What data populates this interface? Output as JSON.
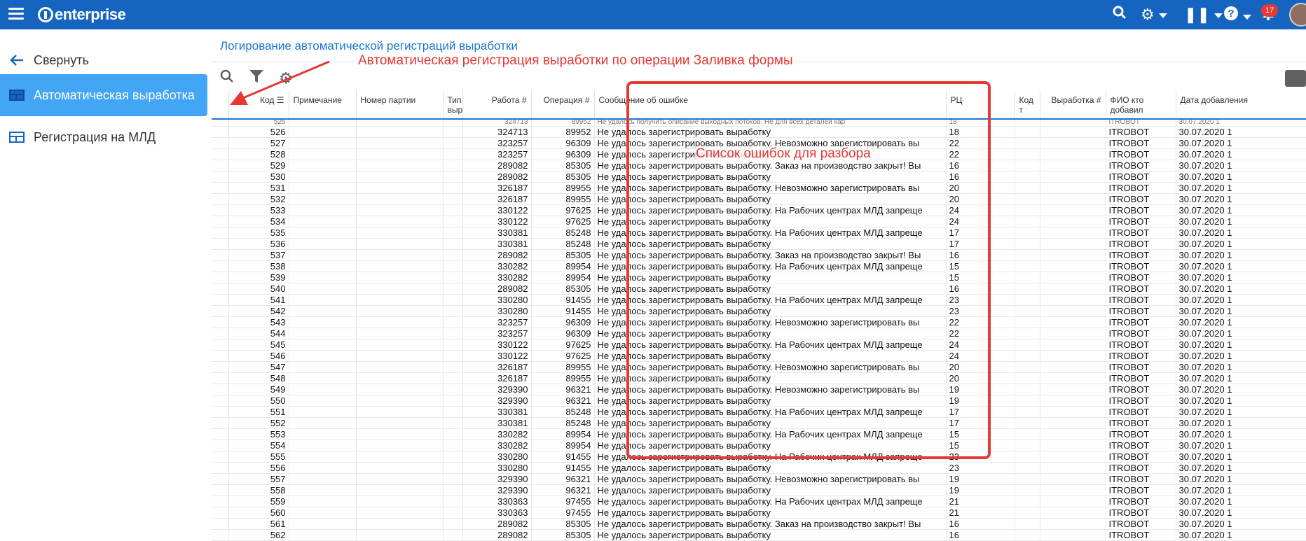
{
  "topbar": {
    "logo_text": "enterprise",
    "notification_count": "17",
    "icons": [
      "menu-icon",
      "search-icon",
      "gear-icon",
      "pause-icon",
      "help-icon",
      "bell-icon"
    ]
  },
  "sidebar": {
    "collapse_label": "Свернуть",
    "items": [
      {
        "label": "Автоматическая выработка",
        "active": true
      },
      {
        "label": "Регистрация на МЛД",
        "active": false
      }
    ]
  },
  "page": {
    "title": "Логирование автоматической регистраций выработки"
  },
  "table": {
    "headers": [
      "",
      "Код",
      "Примечание",
      "Номер партии",
      "Тип выр",
      "Работа #",
      "Операция #",
      "Сообщение об ошибке",
      "РЦ",
      "Код т",
      "Выработка #",
      "ФИО кто добавил",
      "Дата добавления"
    ],
    "cut_row": {
      "kod": "525",
      "rabota": "324713",
      "op": "89952",
      "msg": "Не удалось получить описание выходных потоков. Не для всех деталей кар",
      "rc": "18",
      "fio": "ITROBOT",
      "date": "30.07.2020 1"
    },
    "rows": [
      {
        "kod": "526",
        "rabota": "324713",
        "op": "89952",
        "msg": "Не удалось зарегистрировать выработку",
        "rc": "18"
      },
      {
        "kod": "527",
        "rabota": "323257",
        "op": "96309",
        "msg": "Не удалось зарегистрировать выработку. Невозможно зарегистрировать вы",
        "rc": "22"
      },
      {
        "kod": "528",
        "rabota": "323257",
        "op": "96309",
        "msg": "Не удалось зарегистрировать выработку",
        "rc": "22"
      },
      {
        "kod": "529",
        "rabota": "289082",
        "op": "85305",
        "msg": "Не удалось зарегистрировать выработку. Заказ на производство закрыт! Вы",
        "rc": "16"
      },
      {
        "kod": "530",
        "rabota": "289082",
        "op": "85305",
        "msg": "Не удалось зарегистрировать выработку",
        "rc": "16"
      },
      {
        "kod": "531",
        "rabota": "326187",
        "op": "89955",
        "msg": "Не удалось зарегистрировать выработку. Невозможно зарегистрировать вы",
        "rc": "20"
      },
      {
        "kod": "532",
        "rabota": "326187",
        "op": "89955",
        "msg": "Не удалось зарегистрировать выработку",
        "rc": "20"
      },
      {
        "kod": "533",
        "rabota": "330122",
        "op": "97625",
        "msg": "Не удалось зарегистрировать выработку. На Рабочих центрах МЛД запреще",
        "rc": "24"
      },
      {
        "kod": "534",
        "rabota": "330122",
        "op": "97625",
        "msg": "Не удалось зарегистрировать выработку",
        "rc": "24"
      },
      {
        "kod": "535",
        "rabota": "330381",
        "op": "85248",
        "msg": "Не удалось зарегистрировать выработку. На Рабочих центрах МЛД запреще",
        "rc": "17"
      },
      {
        "kod": "536",
        "rabota": "330381",
        "op": "85248",
        "msg": "Не удалось зарегистрировать выработку",
        "rc": "17"
      },
      {
        "kod": "537",
        "rabota": "289082",
        "op": "85305",
        "msg": "Не удалось зарегистрировать выработку. Заказ на производство закрыт! Вы",
        "rc": "16"
      },
      {
        "kod": "538",
        "rabota": "330282",
        "op": "89954",
        "msg": "Не удалось зарегистрировать выработку. На Рабочих центрах МЛД запреще",
        "rc": "15"
      },
      {
        "kod": "539",
        "rabota": "330282",
        "op": "89954",
        "msg": "Не удалось зарегистрировать выработку",
        "rc": "15"
      },
      {
        "kod": "540",
        "rabota": "289082",
        "op": "85305",
        "msg": "Не удалось зарегистрировать выработку",
        "rc": "16"
      },
      {
        "kod": "541",
        "rabota": "330280",
        "op": "91455",
        "msg": "Не удалось зарегистрировать выработку. На Рабочих центрах МЛД запреще",
        "rc": "23"
      },
      {
        "kod": "542",
        "rabota": "330280",
        "op": "91455",
        "msg": "Не удалось зарегистрировать выработку",
        "rc": "23"
      },
      {
        "kod": "543",
        "rabota": "323257",
        "op": "96309",
        "msg": "Не удалось зарегистрировать выработку. Невозможно зарегистрировать вы",
        "rc": "22"
      },
      {
        "kod": "544",
        "rabota": "323257",
        "op": "96309",
        "msg": "Не удалось зарегистрировать выработку",
        "rc": "22"
      },
      {
        "kod": "545",
        "rabota": "330122",
        "op": "97625",
        "msg": "Не удалось зарегистрировать выработку. На Рабочих центрах МЛД запреще",
        "rc": "24"
      },
      {
        "kod": "546",
        "rabota": "330122",
        "op": "97625",
        "msg": "Не удалось зарегистрировать выработку",
        "rc": "24"
      },
      {
        "kod": "547",
        "rabota": "326187",
        "op": "89955",
        "msg": "Не удалось зарегистрировать выработку. Невозможно зарегистрировать вы",
        "rc": "20"
      },
      {
        "kod": "548",
        "rabota": "326187",
        "op": "89955",
        "msg": "Не удалось зарегистрировать выработку",
        "rc": "20"
      },
      {
        "kod": "549",
        "rabota": "329390",
        "op": "96321",
        "msg": "Не удалось зарегистрировать выработку. Невозможно зарегистрировать вы",
        "rc": "19"
      },
      {
        "kod": "550",
        "rabota": "329390",
        "op": "96321",
        "msg": "Не удалось зарегистрировать выработку",
        "rc": "19"
      },
      {
        "kod": "551",
        "rabota": "330381",
        "op": "85248",
        "msg": "Не удалось зарегистрировать выработку. На Рабочих центрах МЛД запреще",
        "rc": "17"
      },
      {
        "kod": "552",
        "rabota": "330381",
        "op": "85248",
        "msg": "Не удалось зарегистрировать выработку",
        "rc": "17"
      },
      {
        "kod": "553",
        "rabota": "330282",
        "op": "89954",
        "msg": "Не удалось зарегистрировать выработку. На Рабочих центрах МЛД запреще",
        "rc": "15"
      },
      {
        "kod": "554",
        "rabota": "330282",
        "op": "89954",
        "msg": "Не удалось зарегистрировать выработку",
        "rc": "15"
      },
      {
        "kod": "555",
        "rabota": "330280",
        "op": "91455",
        "msg": "Не удалось зарегистрировать выработку. На Рабочих центрах МЛД запреще",
        "rc": "23"
      },
      {
        "kod": "556",
        "rabota": "330280",
        "op": "91455",
        "msg": "Не удалось зарегистрировать выработку",
        "rc": "23"
      },
      {
        "kod": "557",
        "rabota": "329390",
        "op": "96321",
        "msg": "Не удалось зарегистрировать выработку. Невозможно зарегистрировать вы",
        "rc": "19"
      },
      {
        "kod": "558",
        "rabota": "329390",
        "op": "96321",
        "msg": "Не удалось зарегистрировать выработку",
        "rc": "19"
      },
      {
        "kod": "559",
        "rabota": "330363",
        "op": "97455",
        "msg": "Не удалось зарегистрировать выработку. На Рабочих центрах МЛД запреще",
        "rc": "21"
      },
      {
        "kod": "560",
        "rabota": "330363",
        "op": "97455",
        "msg": "Не удалось зарегистрировать выработку",
        "rc": "21"
      },
      {
        "kod": "561",
        "rabota": "289082",
        "op": "85305",
        "msg": "Не удалось зарегистрировать выработку. Заказ на производство закрыт! Вы",
        "rc": "16"
      },
      {
        "kod": "562",
        "rabota": "289082",
        "op": "85305",
        "msg": "Не удалось зарегистрировать выработку",
        "rc": "16"
      }
    ],
    "fio_value": "ITROBOT",
    "date_value": "30.07.2020 1"
  },
  "annotations": {
    "arrow_text": "Автоматическая регистрация выработки по операции Заливка формы",
    "box_text": "Список ошибок для разбора",
    "color": "#e53935"
  },
  "colors": {
    "brand": "#1565c0",
    "active": "#42a5f5",
    "header_accent": "#1976d2"
  }
}
